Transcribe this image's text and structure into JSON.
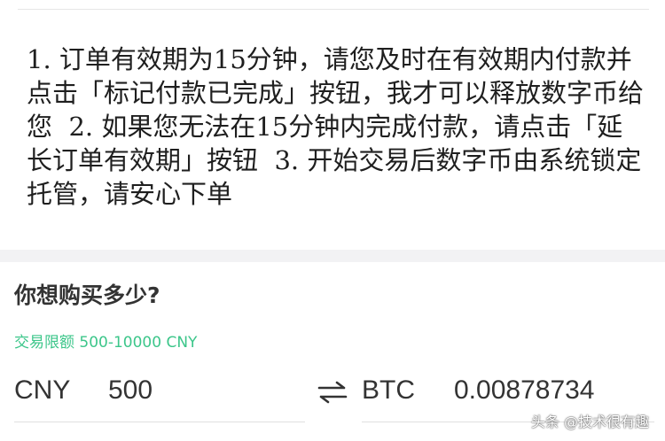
{
  "notice": {
    "item1": "1. 订单有效期为15分钟，请您及时在有效期内付款并点击「标记付款已完成」按钮，我才可以释放数字币给您",
    "item2": "2. 如果您无法在15分钟内完成付款，请点击「延长订单有效期」按钮",
    "item3": "3. 开始交易后数字币由系统锁定托管，请安心下单"
  },
  "purchase": {
    "question": "你想购买多少?",
    "limit_label": "交易限额 500-10000 CNY",
    "fiat_currency": "CNY",
    "fiat_amount": "500",
    "crypto_currency": "BTC",
    "crypto_amount": "0.00878734",
    "swap_icon": "swap-arrows-icon"
  },
  "watermark": "头条 @技术很有趣",
  "colors": {
    "accent_green": "#3cc68a",
    "text_dark": "#222222",
    "divider": "#f2f2f4"
  }
}
